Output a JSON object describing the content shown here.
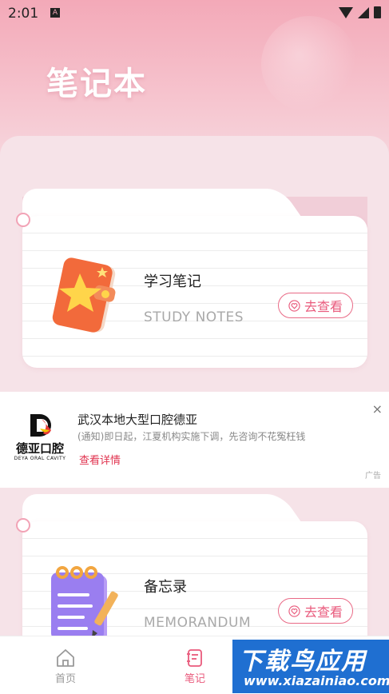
{
  "status_bar": {
    "time": "2:01",
    "notification_icon": "A"
  },
  "header": {
    "title": "笔记本"
  },
  "cards": [
    {
      "title": "学习笔记",
      "subtitle": "STUDY NOTES",
      "button_label": "去查看",
      "icon": "notebook-star-icon"
    },
    {
      "title": "备忘录",
      "subtitle": "MEMORANDUM",
      "button_label": "去查看",
      "icon": "memo-pad-icon"
    }
  ],
  "ad": {
    "logo_main": "德亚口腔",
    "logo_sub": "DEYA ORAL CAVITY",
    "title": "武汉本地大型口腔德亚",
    "description": "(通知)即日起，江夏机构实施下调，先咨询不花冤枉钱",
    "link_label": "查看详情",
    "close": "×",
    "tag": "广告"
  },
  "bottom_nav": [
    {
      "label": "首页",
      "icon": "home-icon",
      "active": false
    },
    {
      "label": "笔记",
      "icon": "notes-icon",
      "active": true
    }
  ],
  "watermark": {
    "main": "下载鸟应用",
    "url": "www.xiazainiao.com"
  },
  "colors": {
    "accent": "#e95a7c",
    "header_pink": "#f3a9b8",
    "watermark_blue": "#1f6fd1"
  }
}
